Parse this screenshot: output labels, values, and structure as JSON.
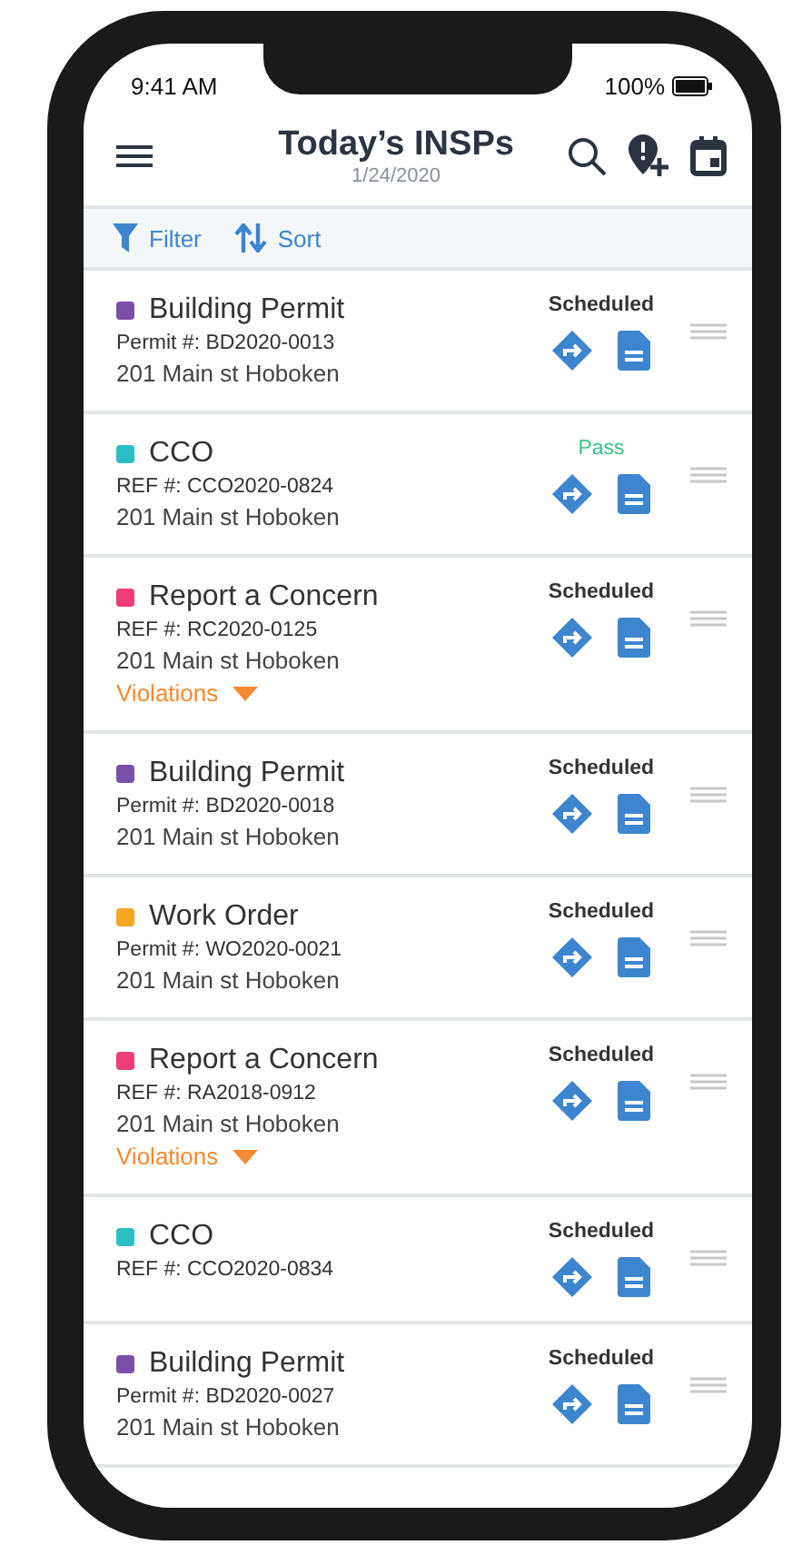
{
  "status_bar": {
    "time": "9:41 AM",
    "battery": "100%"
  },
  "header": {
    "title": "Today’s INSPs",
    "date": "1/24/2020"
  },
  "toolbar": {
    "filter": "Filter",
    "sort": "Sort"
  },
  "inspections": [
    {
      "type": "Building Permit",
      "color": "#7b4fa8",
      "ref": "Permit #: BD2020-0013",
      "address": "201 Main st Hoboken",
      "status": "Scheduled",
      "passed": false
    },
    {
      "type": "CCO",
      "color": "#2bbfc4",
      "ref": "REF #: CCO2020-0824",
      "address": "201 Main st Hoboken",
      "status": "Pass",
      "passed": true
    },
    {
      "type": "Report a Concern",
      "color": "#ee3e7a",
      "ref": "REF #: RC2020-0125",
      "address": "201 Main st Hoboken",
      "status": "Scheduled",
      "passed": false,
      "violations": {
        "label": "Violations",
        "expanded": false
      }
    },
    {
      "type": "Building Permit",
      "color": "#7b4fa8",
      "ref": "Permit #: BD2020-0018",
      "address": "201 Main st Hoboken",
      "status": "Scheduled",
      "passed": false
    },
    {
      "type": "Work Order",
      "color": "#f5a623",
      "ref": "Permit #: WO2020-0021",
      "address": "201 Main st Hoboken",
      "status": "Scheduled",
      "passed": false
    },
    {
      "type": "Report a Concern",
      "color": "#ee3e7a",
      "ref": "REF #: RA2018-0912",
      "address": "201 Main st Hoboken",
      "status": "Scheduled",
      "passed": false,
      "violations": {
        "label": "Violations",
        "expanded": false
      }
    },
    {
      "type": "CCO",
      "color": "#2bbfc4",
      "ref": "REF #: CCO2020-0834",
      "status": "Scheduled",
      "passed": false
    },
    {
      "type": "Building Permit",
      "color": "#7b4fa8",
      "ref": "Permit #: BD2020-0027",
      "address": "201 Main st Hoboken",
      "status": "Scheduled",
      "passed": false
    }
  ]
}
